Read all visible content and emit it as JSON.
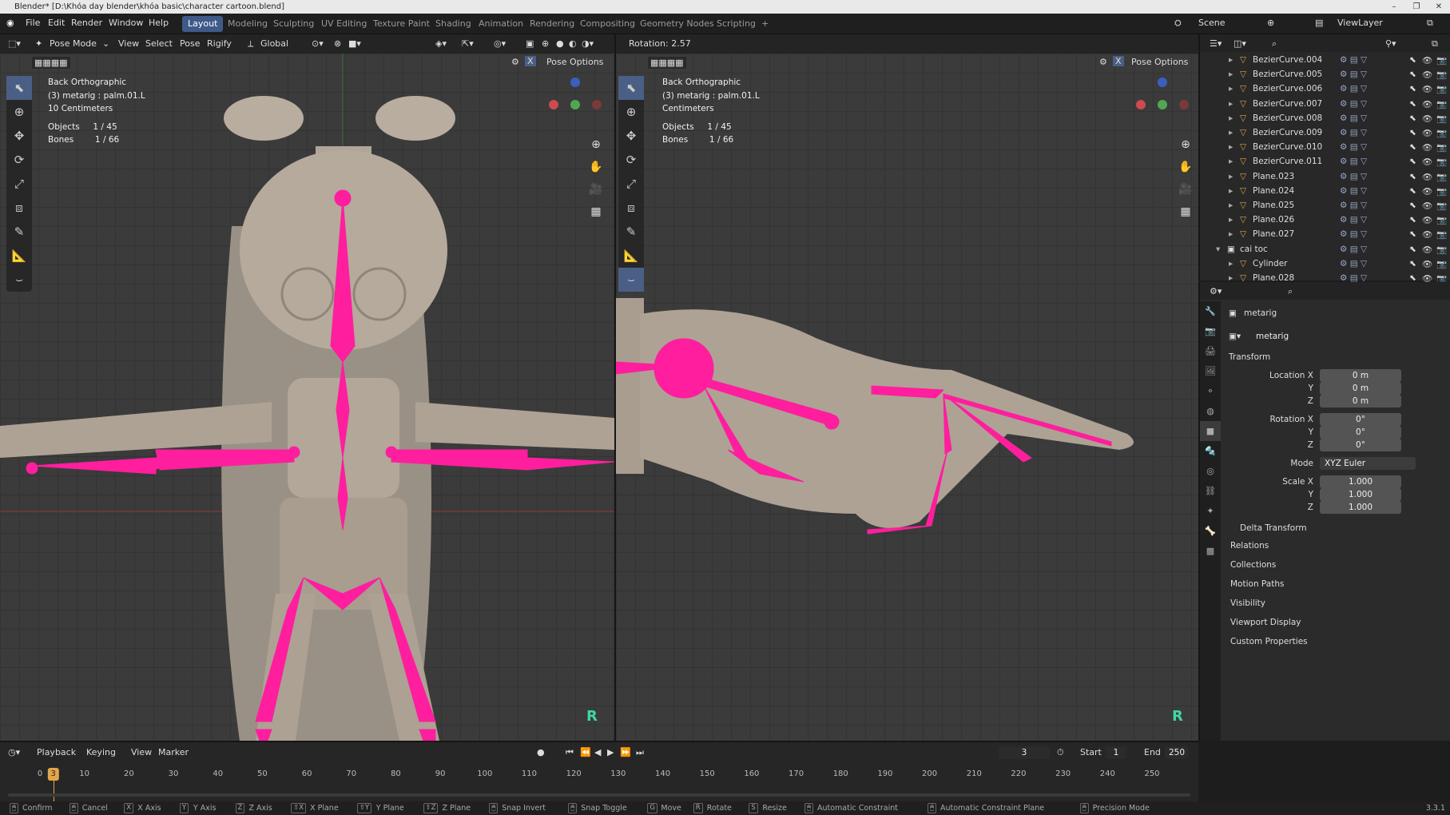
{
  "window": {
    "title": "Blender* [D:\\Khóa day blender\\khóa basic\\character cartoon.blend]",
    "version": "3.3.1"
  },
  "menus": [
    "File",
    "Edit",
    "Render",
    "Window",
    "Help"
  ],
  "workspaces": [
    "Layout",
    "Modeling",
    "Sculpting",
    "UV Editing",
    "Texture Paint",
    "Shading",
    "Animation",
    "Rendering",
    "Compositing",
    "Geometry Nodes",
    "Scripting",
    "+"
  ],
  "active_workspace": "Layout",
  "scene": "Scene",
  "view_layer": "ViewLayer",
  "left_header": {
    "mode": "Pose Mode",
    "items": [
      "View",
      "Select",
      "Pose",
      "Rigify"
    ],
    "orientation": "Global",
    "pose_options": "Pose Options",
    "x_mirror": "X"
  },
  "right_header": {
    "operator_status": "Rotation: 2.57",
    "pose_options": "Pose Options",
    "x_mirror": "X"
  },
  "left_view": {
    "view_name": "Back Orthographic",
    "active": "(3) metarig : palm.01.L",
    "scale": "10 Centimeters",
    "objects_label": "Objects",
    "objects": "1 / 45",
    "bones_label": "Bones",
    "bones": "1 / 66",
    "r_marker": "R"
  },
  "right_view": {
    "view_name": "Back Orthographic",
    "active": "(3) metarig : palm.01.L",
    "scale": "Centimeters",
    "objects_label": "Objects",
    "objects": "1 / 45",
    "bones_label": "Bones",
    "bones": "1 / 66",
    "r_marker": "R"
  },
  "outliner": {
    "items": [
      {
        "name": "BezierCurve.004"
      },
      {
        "name": "BezierCurve.005"
      },
      {
        "name": "BezierCurve.006"
      },
      {
        "name": "BezierCurve.007"
      },
      {
        "name": "BezierCurve.008"
      },
      {
        "name": "BezierCurve.009"
      },
      {
        "name": "BezierCurve.010"
      },
      {
        "name": "BezierCurve.011"
      },
      {
        "name": "Plane.023"
      },
      {
        "name": "Plane.024"
      },
      {
        "name": "Plane.025"
      },
      {
        "name": "Plane.026"
      },
      {
        "name": "Plane.027"
      },
      {
        "name": "cai toc"
      },
      {
        "name": "Cylinder"
      },
      {
        "name": "Plane.028"
      }
    ]
  },
  "properties": {
    "object": "metarig",
    "data": "metarig",
    "transform_label": "Transform",
    "location_label": "Location X",
    "rotation_label": "Rotation X",
    "scale_label": "Scale X",
    "axis_y": "Y",
    "axis_z": "Z",
    "mode_label": "Mode",
    "location": [
      "0 m",
      "0 m",
      "0 m"
    ],
    "rotation": [
      "0°",
      "0°",
      "0°"
    ],
    "mode": "XYZ Euler",
    "scale": [
      "1.000",
      "1.000",
      "1.000"
    ],
    "sections": [
      "Delta Transform",
      "Relations",
      "Collections",
      "Motion Paths",
      "Visibility",
      "Viewport Display",
      "Custom Properties"
    ]
  },
  "timeline": {
    "menus": [
      "Playback",
      "Keying",
      "View",
      "Marker"
    ],
    "current_frame": "3",
    "start_label": "Start",
    "start": "1",
    "end_label": "End",
    "end": "250",
    "ticks": [
      "0",
      "10",
      "20",
      "30",
      "40",
      "50",
      "60",
      "70",
      "80",
      "90",
      "100",
      "110",
      "120",
      "130",
      "140",
      "150",
      "160",
      "170",
      "180",
      "190",
      "200",
      "210",
      "220",
      "230",
      "240",
      "250"
    ],
    "playhead": "3"
  },
  "statusbar": [
    {
      "key": "",
      "label": "Confirm"
    },
    {
      "key": "",
      "label": "Cancel"
    },
    {
      "key": "X",
      "label": "X Axis"
    },
    {
      "key": "Y",
      "label": "Y Axis"
    },
    {
      "key": "Z",
      "label": "Z Axis"
    },
    {
      "key": "⇧X",
      "label": "X Plane"
    },
    {
      "key": "⇧Y",
      "label": "Y Plane"
    },
    {
      "key": "⇧Z",
      "label": "Z Plane"
    },
    {
      "key": "",
      "label": "Snap Invert"
    },
    {
      "key": "",
      "label": "Snap Toggle"
    },
    {
      "key": "G",
      "label": "Move"
    },
    {
      "key": "R",
      "label": "Rotate"
    },
    {
      "key": "S",
      "label": "Resize"
    },
    {
      "key": "",
      "label": "Automatic Constraint"
    },
    {
      "key": "",
      "label": "Automatic Constraint Plane"
    },
    {
      "key": "",
      "label": "Precision Mode"
    }
  ],
  "colors": {
    "bone": "#ff1e9e",
    "accent": "#3f5a89",
    "r_marker": "#3ed6a6"
  }
}
